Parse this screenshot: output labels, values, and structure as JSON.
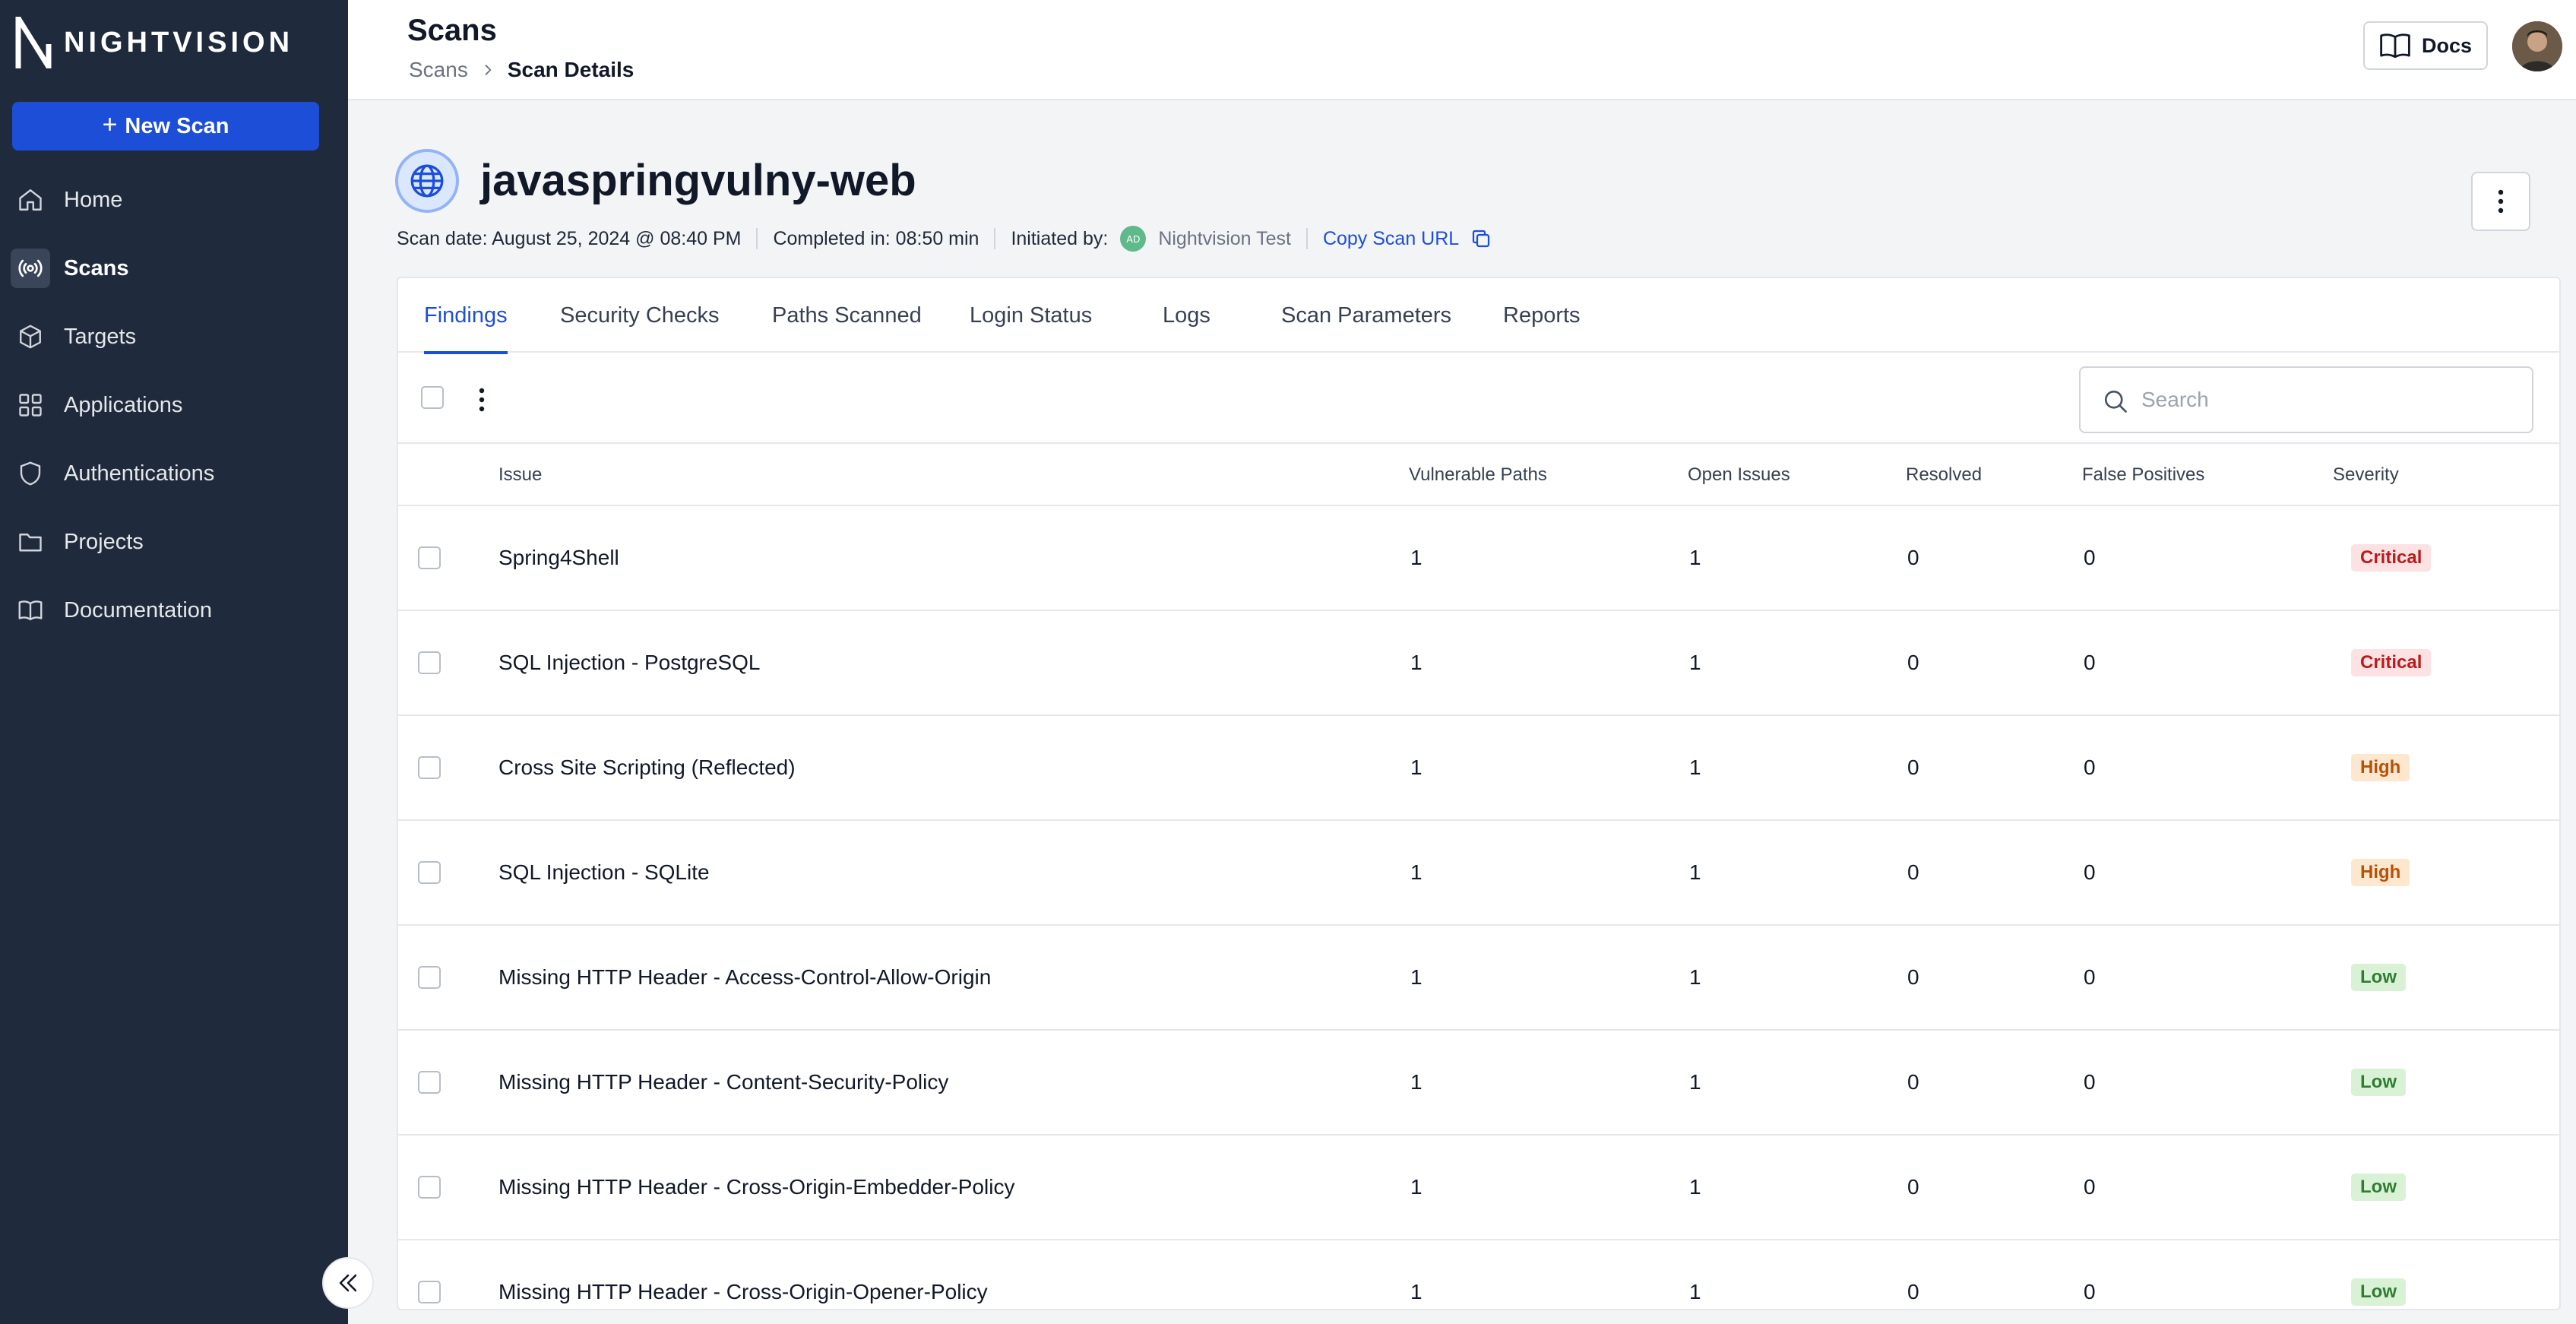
{
  "app": {
    "logo_text": "NIGHTVISION"
  },
  "sidebar": {
    "new_scan_label": "New Scan",
    "items": [
      {
        "label": "Home",
        "icon": "home-icon",
        "active": false
      },
      {
        "label": "Scans",
        "icon": "broadcast-icon",
        "active": true
      },
      {
        "label": "Targets",
        "icon": "cube-icon",
        "active": false
      },
      {
        "label": "Applications",
        "icon": "grid-icon",
        "active": false
      },
      {
        "label": "Authentications",
        "icon": "shield-icon",
        "active": false
      },
      {
        "label": "Projects",
        "icon": "folder-icon",
        "active": false
      },
      {
        "label": "Documentation",
        "icon": "book-icon",
        "active": false
      }
    ]
  },
  "header": {
    "title": "Scans",
    "breadcrumb": [
      "Scans",
      "Scan Details"
    ],
    "docs_label": "Docs"
  },
  "scan": {
    "name": "javaspringvulny-web",
    "scan_date": "Scan date: August 25, 2024 @ 08:40 PM",
    "completed_in": "Completed in: 08:50 min",
    "initiated_by_label": "Initiated by:",
    "initiator_initials": "AD",
    "initiator_name": "Nightvision Test",
    "copy_url_label": "Copy Scan URL"
  },
  "tabs": [
    "Findings",
    "Security Checks",
    "Paths Scanned",
    "Login Status",
    "Logs",
    "Scan Parameters",
    "Reports"
  ],
  "active_tab": "Findings",
  "search": {
    "placeholder": "Search",
    "value": ""
  },
  "table": {
    "columns": [
      "Issue",
      "Vulnerable Paths",
      "Open Issues",
      "Resolved",
      "False Positives",
      "Severity"
    ],
    "rows": [
      {
        "issue": "Spring4Shell",
        "paths": "1",
        "open": "1",
        "resolved": "0",
        "false_positives": "0",
        "severity": "Critical"
      },
      {
        "issue": "SQL Injection - PostgreSQL",
        "paths": "1",
        "open": "1",
        "resolved": "0",
        "false_positives": "0",
        "severity": "Critical"
      },
      {
        "issue": "Cross Site Scripting (Reflected)",
        "paths": "1",
        "open": "1",
        "resolved": "0",
        "false_positives": "0",
        "severity": "High"
      },
      {
        "issue": "SQL Injection - SQLite",
        "paths": "1",
        "open": "1",
        "resolved": "0",
        "false_positives": "0",
        "severity": "High"
      },
      {
        "issue": "Missing HTTP Header - Access-Control-Allow-Origin",
        "paths": "1",
        "open": "1",
        "resolved": "0",
        "false_positives": "0",
        "severity": "Low"
      },
      {
        "issue": "Missing HTTP Header - Content-Security-Policy",
        "paths": "1",
        "open": "1",
        "resolved": "0",
        "false_positives": "0",
        "severity": "Low"
      },
      {
        "issue": "Missing HTTP Header - Cross-Origin-Embedder-Policy",
        "paths": "1",
        "open": "1",
        "resolved": "0",
        "false_positives": "0",
        "severity": "Low"
      },
      {
        "issue": "Missing HTTP Header - Cross-Origin-Opener-Policy",
        "paths": "1",
        "open": "1",
        "resolved": "0",
        "false_positives": "0",
        "severity": "Low"
      }
    ]
  },
  "colors": {
    "sidebar_bg": "#1f2a3c",
    "accent": "#1d4ed8",
    "critical": "#b91c1c",
    "high": "#b45309",
    "low": "#2f7d32"
  }
}
